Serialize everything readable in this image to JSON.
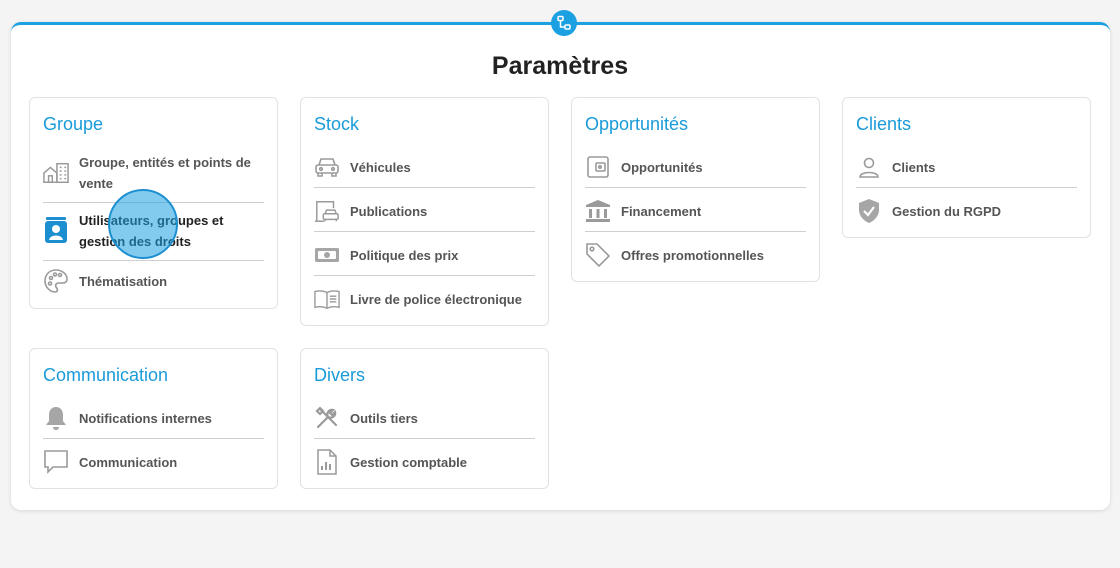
{
  "page": {
    "title": "Paramètres",
    "accent_color": "#1ba0e2",
    "badge_icon": "network-icon"
  },
  "cards": {
    "groupe": {
      "title": "Groupe",
      "items": [
        {
          "label": "Groupe, entités et points de vente",
          "icon": "building-icon"
        },
        {
          "label": "Utilisateurs, groupes et gestion des droits",
          "icon": "contact-book-icon",
          "active": true
        },
        {
          "label": "Thématisation",
          "icon": "palette-icon"
        }
      ]
    },
    "stock": {
      "title": "Stock",
      "items": [
        {
          "label": "Véhicules",
          "icon": "car-icon"
        },
        {
          "label": "Publications",
          "icon": "car-publication-icon"
        },
        {
          "label": "Politique des prix",
          "icon": "banknote-icon"
        },
        {
          "label": "Livre de police électronique",
          "icon": "open-book-icon"
        }
      ]
    },
    "opportunites": {
      "title": "Opportunités",
      "items": [
        {
          "label": "Opportunités",
          "icon": "wallet-icon"
        },
        {
          "label": "Financement",
          "icon": "bank-icon"
        },
        {
          "label": "Offres promotionnelles",
          "icon": "tag-icon"
        }
      ]
    },
    "clients": {
      "title": "Clients",
      "items": [
        {
          "label": "Clients",
          "icon": "user-icon"
        },
        {
          "label": "Gestion du RGPD",
          "icon": "shield-check-icon"
        }
      ]
    },
    "communication": {
      "title": "Communication",
      "items": [
        {
          "label": "Notifications internes",
          "icon": "bell-icon"
        },
        {
          "label": "Communication",
          "icon": "speech-bubble-icon"
        }
      ]
    },
    "divers": {
      "title": "Divers",
      "items": [
        {
          "label": "Outils tiers",
          "icon": "tools-icon"
        },
        {
          "label": "Gestion comptable",
          "icon": "accounting-document-icon"
        }
      ]
    }
  }
}
